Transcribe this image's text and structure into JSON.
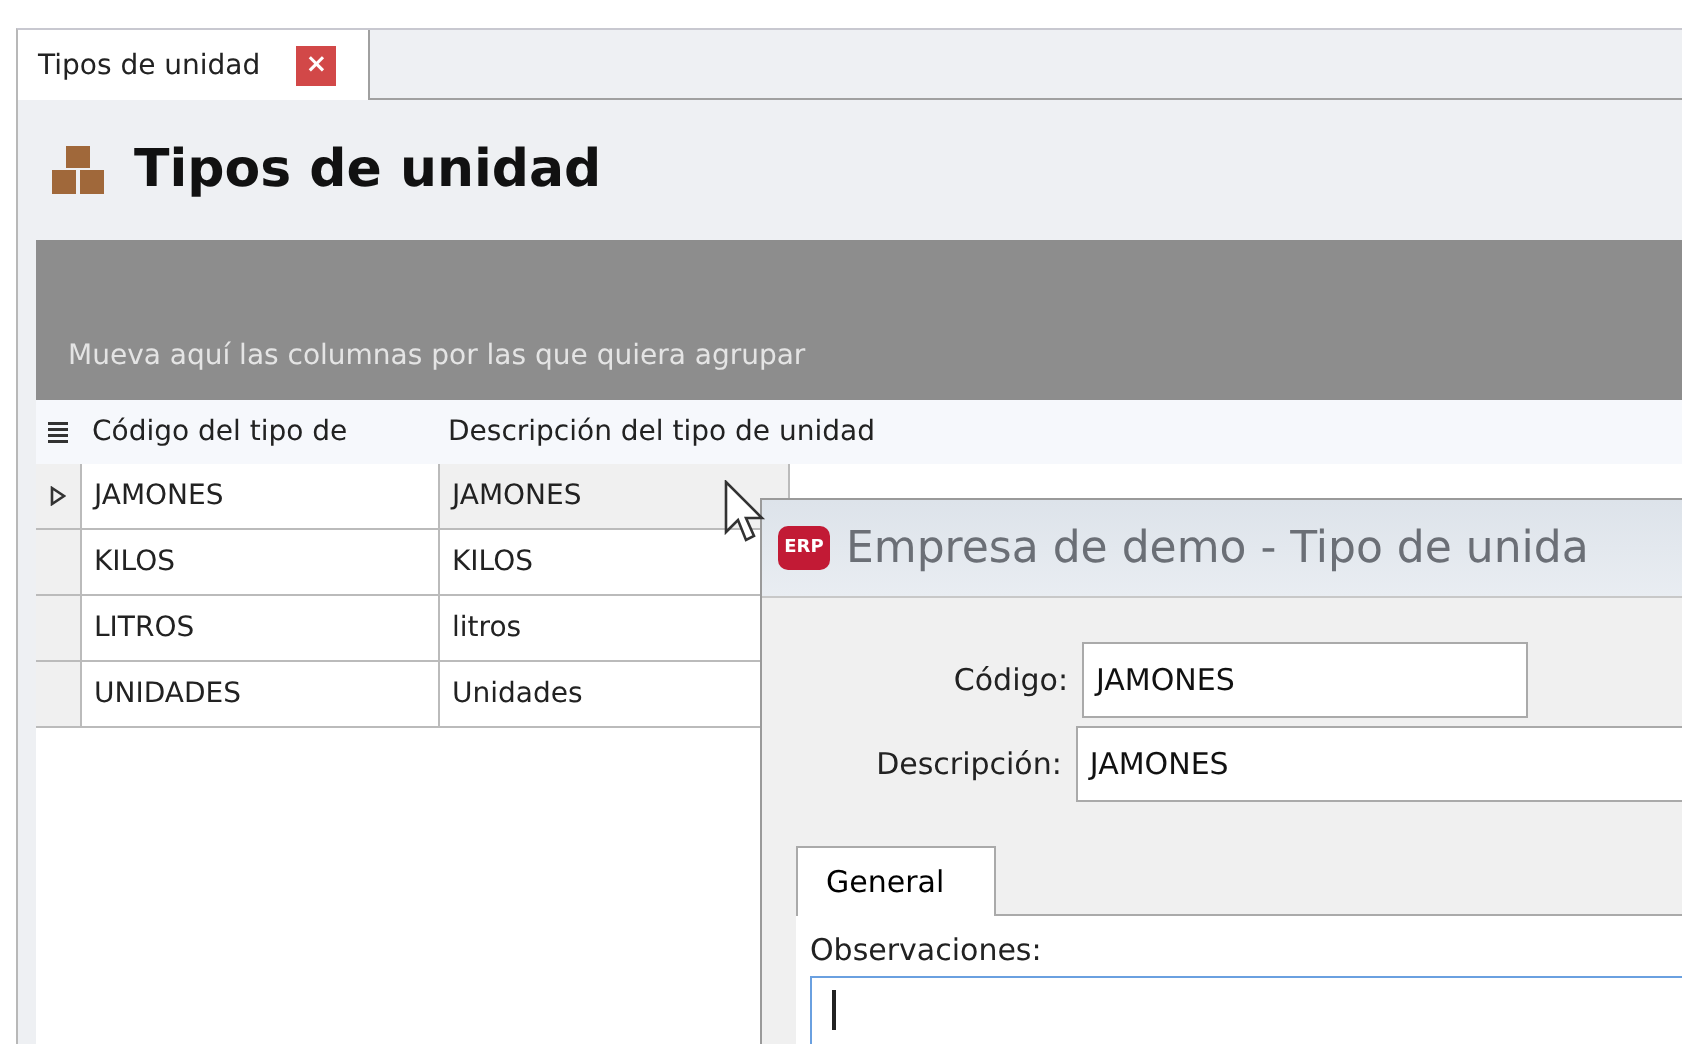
{
  "document_tab": {
    "label": "Tipos de unidad",
    "close": "×",
    "selected": true
  },
  "page_title": "Tipos de unidad",
  "group_panel": {
    "placeholder": "Mueva aquí las columnas por las que quiera agrupar"
  },
  "table": {
    "columns": [
      "Código del tipo de",
      "Descripción del tipo de unidad"
    ],
    "rows": [
      {
        "cells": [
          "JAMONES",
          "JAMONES"
        ],
        "selected": true
      },
      {
        "cells": [
          "KILOS",
          "KILOS"
        ],
        "selected": false
      },
      {
        "cells": [
          "LITROS",
          "litros"
        ],
        "selected": false
      },
      {
        "cells": [
          "UNIDADES",
          "Unidades"
        ],
        "selected": false
      }
    ]
  },
  "dialog": {
    "title": "Empresa de demo - Tipo de unida",
    "logo": "ERP",
    "fields": [
      {
        "label": "Código:",
        "value": "JAMONES",
        "kind": "short"
      },
      {
        "label": "Descripción:",
        "value": "JAMONES",
        "kind": "wide"
      }
    ],
    "tabs": [
      {
        "label": "General",
        "selected": true
      }
    ],
    "notes_label": "Observaciones:"
  }
}
